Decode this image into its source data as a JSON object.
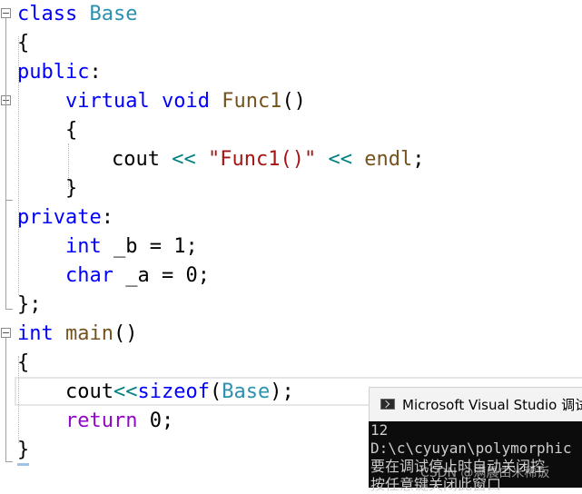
{
  "editor": {
    "lines": [
      {
        "tokens": [
          [
            "kw",
            "class"
          ],
          [
            "plain",
            " "
          ],
          [
            "type",
            "Base"
          ]
        ]
      },
      {
        "tokens": [
          [
            "plain",
            "{"
          ]
        ]
      },
      {
        "tokens": [
          [
            "kw",
            "public"
          ],
          [
            "plain",
            ":"
          ]
        ]
      },
      {
        "tokens": [
          [
            "kw",
            "virtual"
          ],
          [
            "plain",
            " "
          ],
          [
            "kw",
            "void"
          ],
          [
            "plain",
            " "
          ],
          [
            "fn",
            "Func1"
          ],
          [
            "plain",
            "()"
          ]
        ]
      },
      {
        "tokens": [
          [
            "plain",
            "{"
          ]
        ]
      },
      {
        "tokens": [
          [
            "plain",
            "cout "
          ],
          [
            "op",
            "<<"
          ],
          [
            "plain",
            " "
          ],
          [
            "str",
            "\"Func1()\""
          ],
          [
            "plain",
            " "
          ],
          [
            "op",
            "<<"
          ],
          [
            "plain",
            " "
          ],
          [
            "fn",
            "endl"
          ],
          [
            "plain",
            ";"
          ]
        ]
      },
      {
        "tokens": [
          [
            "plain",
            "}"
          ]
        ]
      },
      {
        "tokens": [
          [
            "kw",
            "private"
          ],
          [
            "plain",
            ":"
          ]
        ]
      },
      {
        "tokens": [
          [
            "kw",
            "int"
          ],
          [
            "plain",
            " _b = 1;"
          ]
        ]
      },
      {
        "tokens": [
          [
            "kw",
            "char"
          ],
          [
            "plain",
            " _a = 0;"
          ]
        ]
      },
      {
        "tokens": [
          [
            "plain",
            "};"
          ]
        ]
      },
      {
        "tokens": [
          [
            "kw",
            "int"
          ],
          [
            "plain",
            " "
          ],
          [
            "fn",
            "main"
          ],
          [
            "plain",
            "()"
          ]
        ]
      },
      {
        "tokens": [
          [
            "plain",
            "{"
          ]
        ]
      },
      {
        "tokens": [
          [
            "plain",
            "cout"
          ],
          [
            "op",
            "<<"
          ],
          [
            "kw",
            "sizeof"
          ],
          [
            "plain",
            "("
          ],
          [
            "type",
            "Base"
          ],
          [
            "plain",
            ");"
          ]
        ]
      },
      {
        "tokens": [
          [
            "kw2",
            "return"
          ],
          [
            "plain",
            " 0;"
          ]
        ]
      },
      {
        "tokens": [
          [
            "plain",
            "}"
          ]
        ]
      }
    ]
  },
  "console": {
    "title": "Microsoft Visual Studio 调试",
    "icon": "console-app-icon",
    "output": [
      "12",
      "D:\\c\\cyuyan\\polymorphic",
      "要在调试停止时自动关闭控",
      "按任意键关闭此窗口"
    ]
  },
  "watermark": "CSDN @满晨由米稀饭"
}
